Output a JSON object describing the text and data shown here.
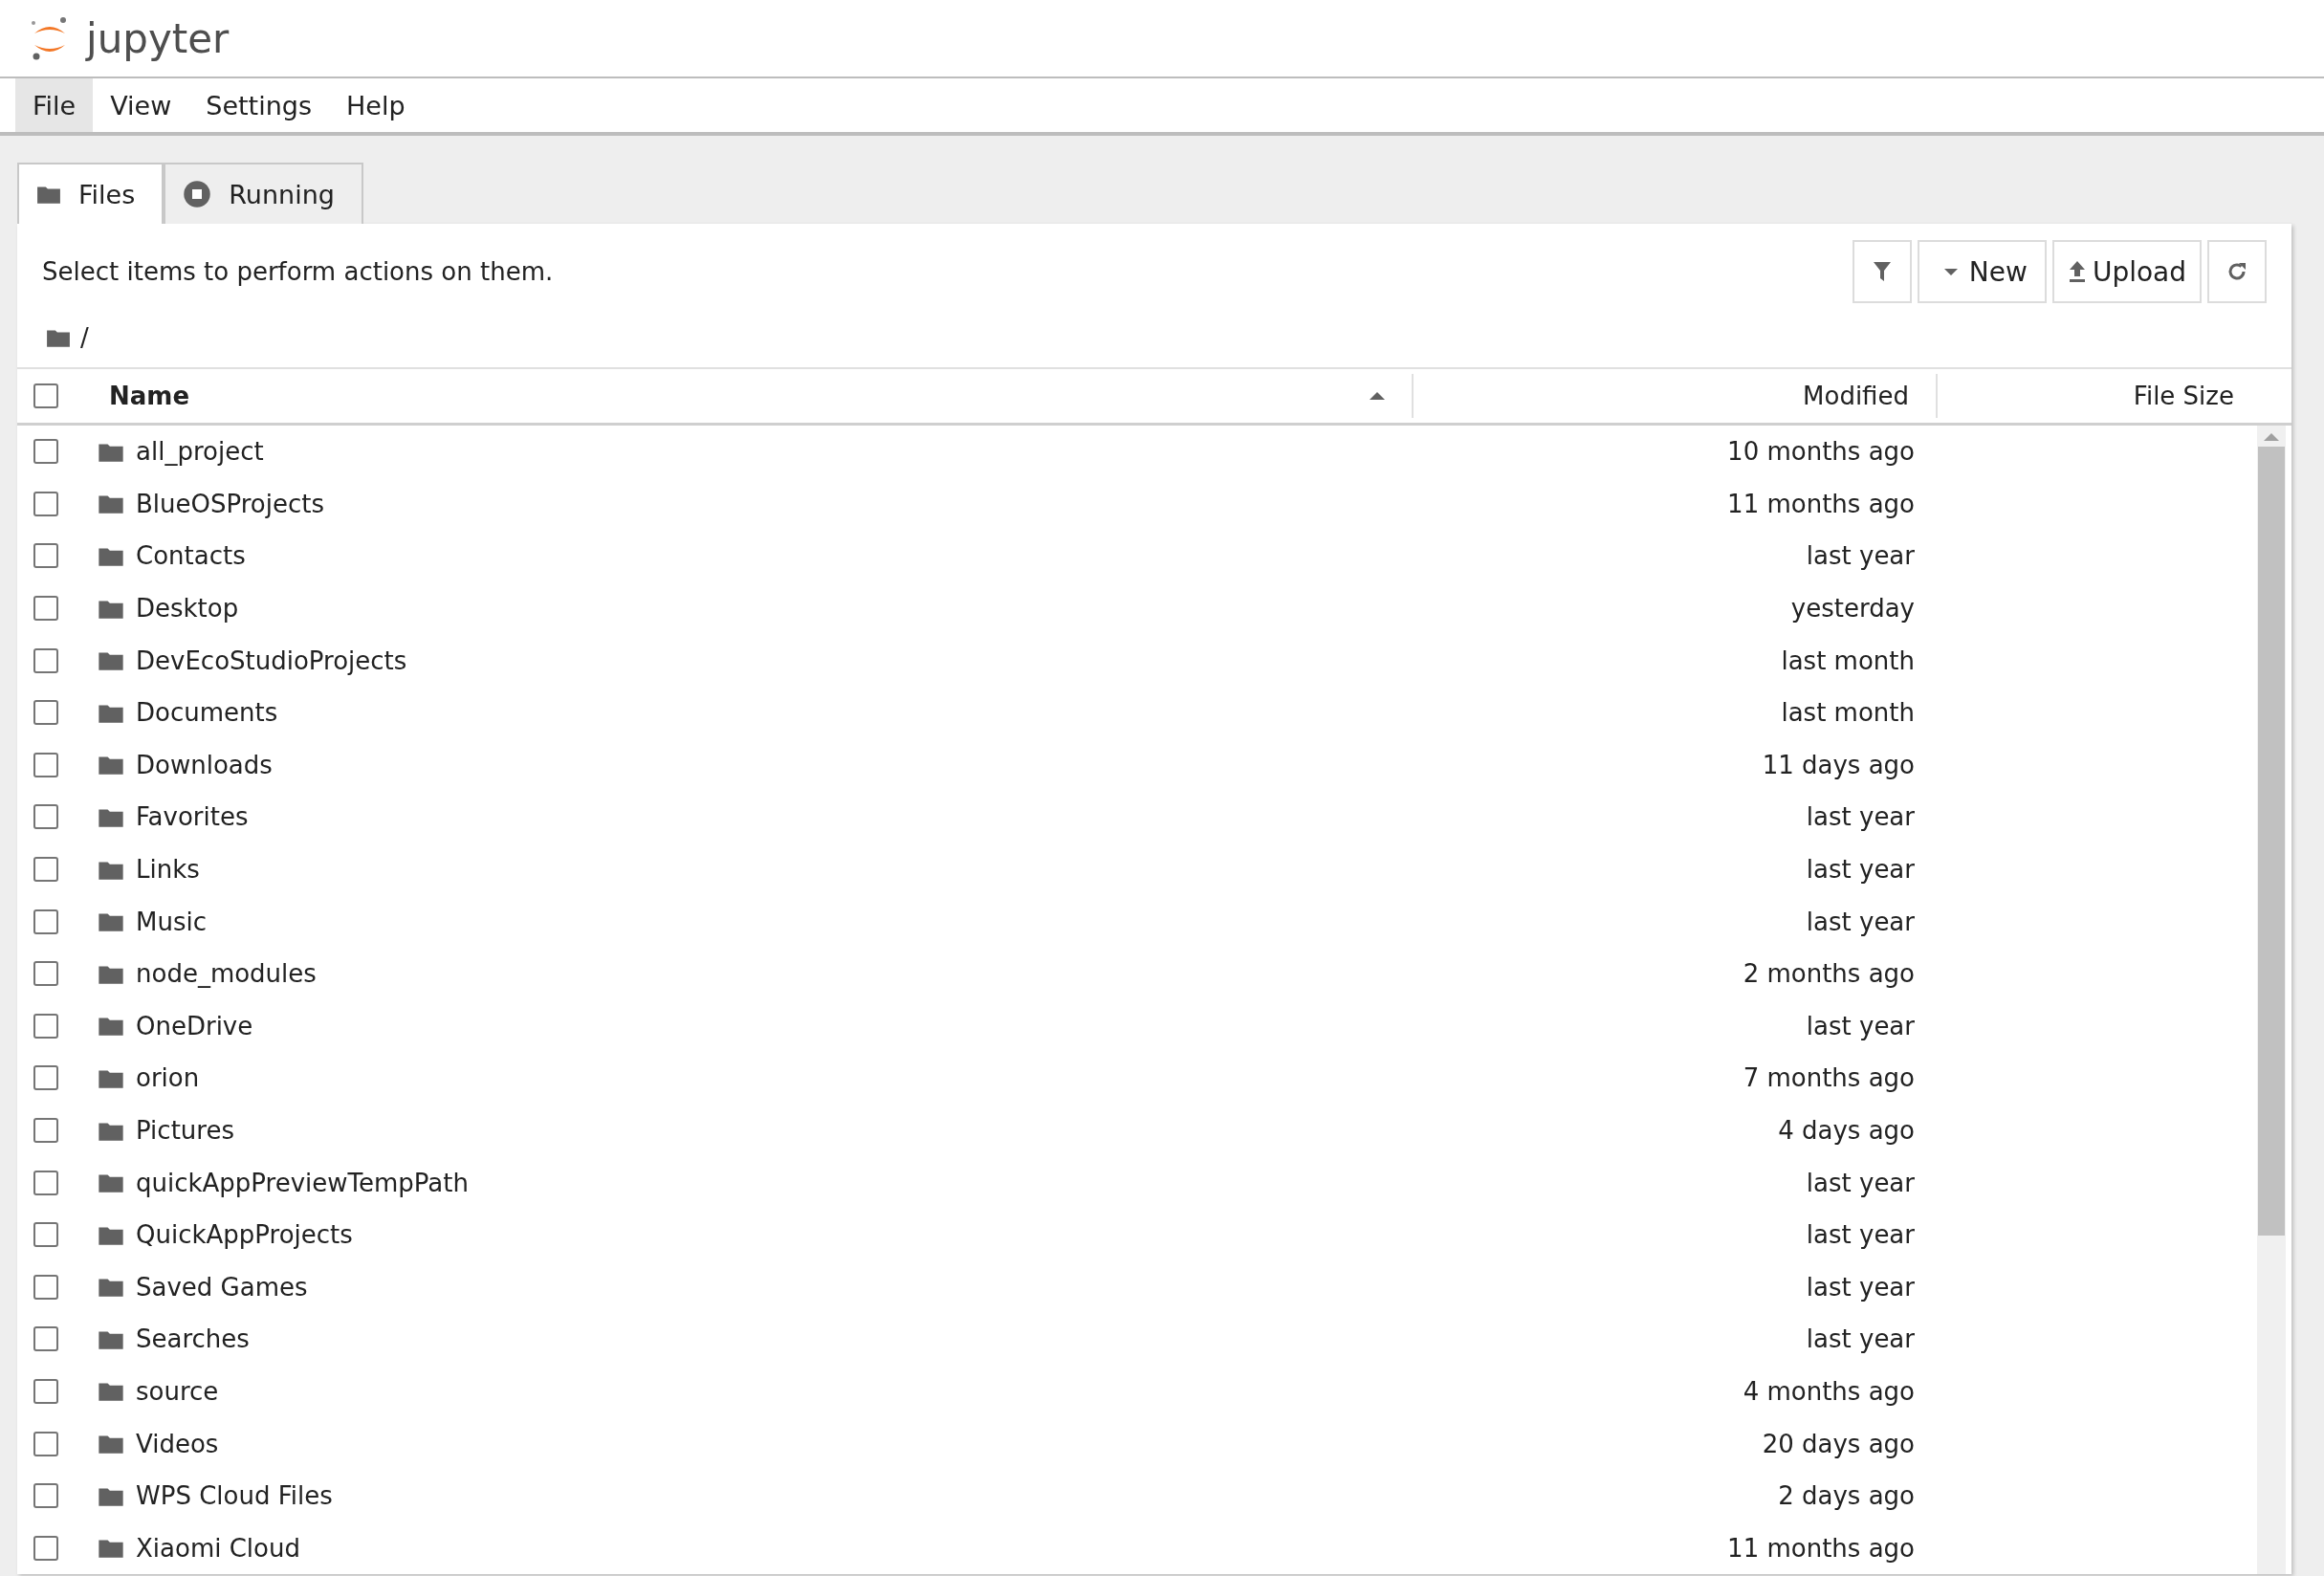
{
  "app": {
    "logo": "jupyter"
  },
  "menu": [
    {
      "label": "File",
      "selected": true
    },
    {
      "label": "View",
      "selected": false
    },
    {
      "label": "Settings",
      "selected": false
    },
    {
      "label": "Help",
      "selected": false
    }
  ],
  "tabs": [
    {
      "label": "Files",
      "kind": "folder",
      "selected": true
    },
    {
      "label": "Running",
      "kind": "stop",
      "selected": false
    }
  ],
  "hint": "Select items to perform actions on them.",
  "toolbar": [
    {
      "kind": "filter"
    },
    {
      "kind": "new",
      "label": "New"
    },
    {
      "kind": "upload",
      "label": "Upload"
    },
    {
      "kind": "refresh"
    }
  ],
  "breadcrumb": "/",
  "table": {
    "select_all": false,
    "columns": [
      {
        "label": "Name",
        "sorted": true
      },
      {
        "label": "Modified",
        "sorted": false
      },
      {
        "label": "File Size",
        "sorted": false
      }
    ],
    "rows": [
      {
        "name": "all_project",
        "modified": "10 months ago",
        "checked": false
      },
      {
        "name": "BlueOSProjects",
        "modified": "11 months ago",
        "checked": false
      },
      {
        "name": "Contacts",
        "modified": "last year",
        "checked": false
      },
      {
        "name": "Desktop",
        "modified": "yesterday",
        "checked": false
      },
      {
        "name": "DevEcoStudioProjects",
        "modified": "last month",
        "checked": false
      },
      {
        "name": "Documents",
        "modified": "last month",
        "checked": false
      },
      {
        "name": "Downloads",
        "modified": "11 days ago",
        "checked": false
      },
      {
        "name": "Favorites",
        "modified": "last year",
        "checked": false
      },
      {
        "name": "Links",
        "modified": "last year",
        "checked": false
      },
      {
        "name": "Music",
        "modified": "last year",
        "checked": false
      },
      {
        "name": "node_modules",
        "modified": "2 months ago",
        "checked": false
      },
      {
        "name": "OneDrive",
        "modified": "last year",
        "checked": false
      },
      {
        "name": "orion",
        "modified": "7 months ago",
        "checked": false
      },
      {
        "name": "Pictures",
        "modified": "4 days ago",
        "checked": false
      },
      {
        "name": "quickAppPreviewTempPath",
        "modified": "last year",
        "checked": false
      },
      {
        "name": "QuickAppProjects",
        "modified": "last year",
        "checked": false
      },
      {
        "name": "Saved Games",
        "modified": "last year",
        "checked": false
      },
      {
        "name": "Searches",
        "modified": "last year",
        "checked": false
      },
      {
        "name": "source",
        "modified": "4 months ago",
        "checked": false
      },
      {
        "name": "Videos",
        "modified": "20 days ago",
        "checked": false
      },
      {
        "name": "WPS Cloud Files",
        "modified": "2 days ago",
        "checked": false
      },
      {
        "name": "Xiaomi Cloud",
        "modified": "11 months ago",
        "checked": false
      }
    ]
  }
}
